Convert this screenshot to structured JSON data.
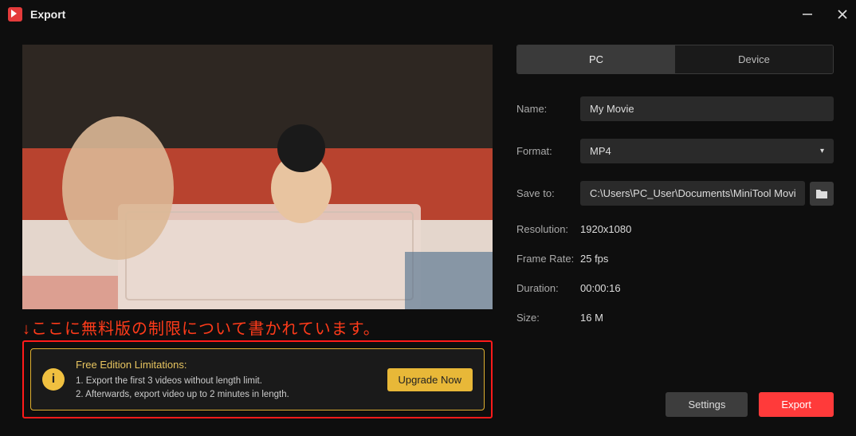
{
  "window": {
    "title": "Export"
  },
  "tabs": {
    "pc": "PC",
    "device": "Device"
  },
  "fields": {
    "name_label": "Name:",
    "name_value": "My Movie",
    "format_label": "Format:",
    "format_value": "MP4",
    "saveto_label": "Save to:",
    "saveto_value": "C:\\Users\\PC_User\\Documents\\MiniTool MovieMak",
    "resolution_label": "Resolution:",
    "resolution_value": "1920x1080",
    "framerate_label": "Frame Rate:",
    "framerate_value": "25 fps",
    "duration_label": "Duration:",
    "duration_value": "00:00:16",
    "size_label": "Size:",
    "size_value": "16 M"
  },
  "annotation": "↓ここに無料版の制限について書かれています。",
  "limitations": {
    "title": "Free Edition Limitations:",
    "line1": "1. Export the first 3 videos without length limit.",
    "line2": "2. Afterwards, export video up to 2 minutes in length.",
    "upgrade": "Upgrade Now"
  },
  "buttons": {
    "settings": "Settings",
    "export": "Export"
  }
}
